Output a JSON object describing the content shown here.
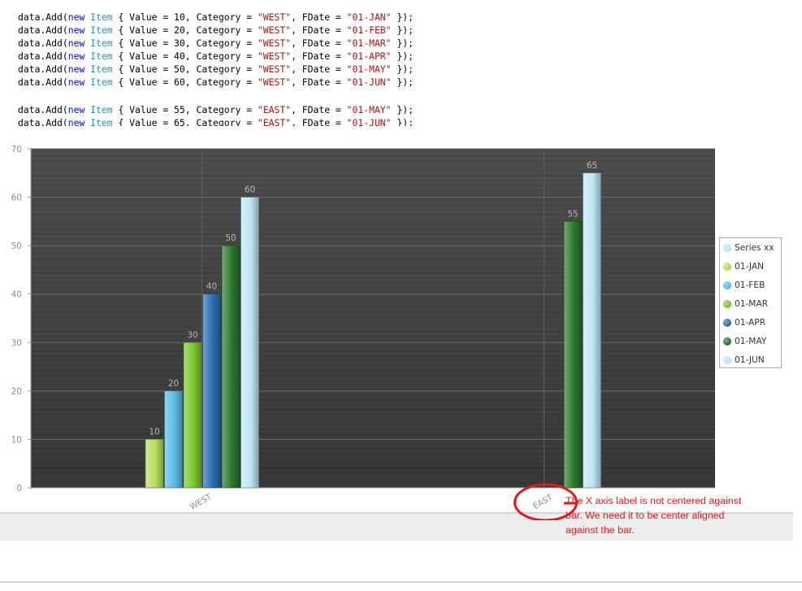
{
  "code_lines": [
    {
      "value": "10",
      "category": "WEST",
      "fdate": "01-JAN"
    },
    {
      "value": "20",
      "category": "WEST",
      "fdate": "01-FEB"
    },
    {
      "value": "30",
      "category": "WEST",
      "fdate": "01-MAR"
    },
    {
      "value": "40",
      "category": "WEST",
      "fdate": "01-APR"
    },
    {
      "value": "50",
      "category": "WEST",
      "fdate": "01-MAY"
    },
    {
      "value": "60",
      "category": "WEST",
      "fdate": "01-JUN"
    },
    {
      "blank": true
    },
    {
      "value": "55",
      "category": "EAST",
      "fdate": "01-MAY"
    },
    {
      "value": "65",
      "category": "EAST",
      "fdate": "01-JUN"
    }
  ],
  "code_tokens": {
    "prefix": "data.Add(",
    "new_kw": "new",
    "type": "Item",
    "value_key": "{ Value = ",
    "category_key": ", Category = ",
    "fdate_key": ", FDate = ",
    "suffix": " });"
  },
  "chart_data": {
    "type": "bar",
    "categories": [
      "WEST",
      "EAST"
    ],
    "ylim": [
      0,
      70
    ],
    "yticks": [
      0,
      10,
      20,
      30,
      40,
      50,
      60,
      70
    ],
    "grid": true,
    "legend_placement": "right",
    "series": [
      {
        "name": "Series xx",
        "values": [
          null,
          null
        ],
        "color": "#bde7f5"
      },
      {
        "name": "01-JAN",
        "values": [
          10,
          null
        ],
        "color": "#b5e05a"
      },
      {
        "name": "01-FEB",
        "values": [
          20,
          null
        ],
        "color": "#5bbde6"
      },
      {
        "name": "01-MAR",
        "values": [
          30,
          null
        ],
        "color": "#7ec82e"
      },
      {
        "name": "01-APR",
        "values": [
          40,
          null
        ],
        "color": "#2a6fb5"
      },
      {
        "name": "01-MAY",
        "values": [
          50,
          55
        ],
        "color": "#2b7a2e"
      },
      {
        "name": "01-JUN",
        "values": [
          60,
          65
        ],
        "color": "#bde7f5"
      }
    ]
  },
  "annotation": {
    "text": "The X axis label is not centered against bar.  We need it to be center aligned against the bar.",
    "color": "#e0191b"
  },
  "colors": {
    "plot_bg_top": "#4a4a4a",
    "plot_bg_bottom": "#353535",
    "axis_text": "#8c8c8c",
    "data_label": "#b8b8b8",
    "highlight_circle": "#e0191b"
  }
}
